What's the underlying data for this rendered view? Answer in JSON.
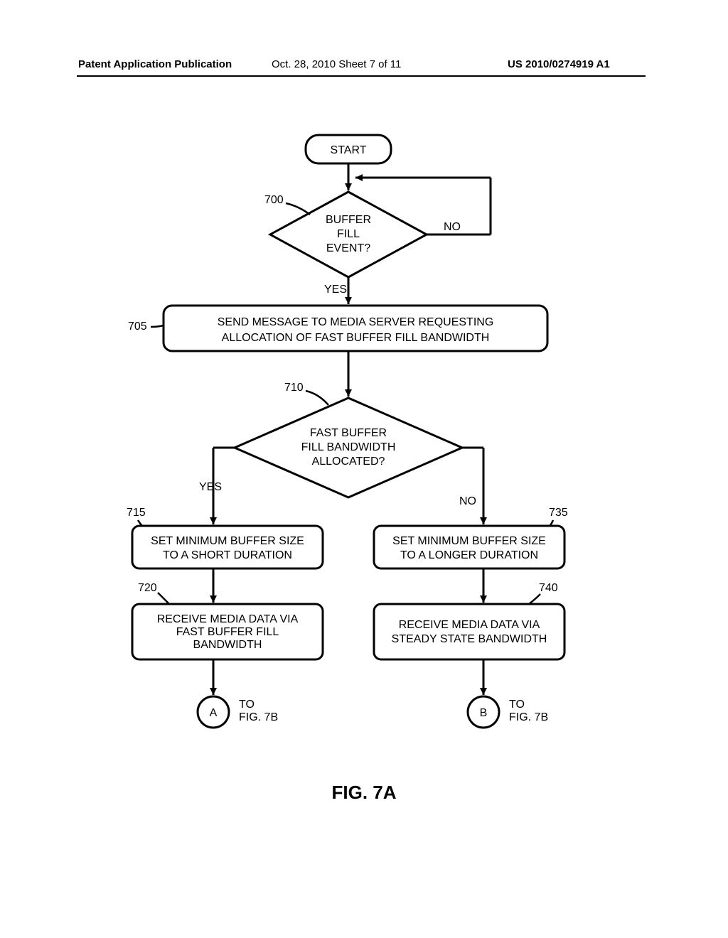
{
  "header": {
    "left": "Patent Application Publication",
    "mid": "Oct. 28, 2010   Sheet 7 of 11",
    "right": "US 2010/0274919 A1"
  },
  "nodes": {
    "start": "START",
    "decision1_l1": "BUFFER",
    "decision1_l2": "FILL",
    "decision1_l3": "EVENT?",
    "process1_l1": "SEND MESSAGE TO MEDIA SERVER REQUESTING",
    "process1_l2": "ALLOCATION OF FAST BUFFER FILL BANDWIDTH",
    "decision2_l1": "FAST BUFFER",
    "decision2_l2": "FILL BANDWIDTH",
    "decision2_l3": "ALLOCATED?",
    "left1_l1": "SET MINIMUM BUFFER SIZE",
    "left1_l2": "TO A SHORT DURATION",
    "left2_l1": "RECEIVE MEDIA DATA VIA",
    "left2_l2": "FAST BUFFER FILL",
    "left2_l3": "BANDWIDTH",
    "right1_l1": "SET MINIMUM BUFFER SIZE",
    "right1_l2": "TO A LONGER DURATION",
    "right2_l1": "RECEIVE MEDIA DATA VIA",
    "right2_l2": "STEADY STATE BANDWIDTH",
    "connA": "A",
    "connB": "B",
    "toA_l1": "TO",
    "toA_l2": "FIG. 7B",
    "toB_l1": "TO",
    "toB_l2": "FIG. 7B"
  },
  "edges": {
    "yes": "YES",
    "no": "NO",
    "yes2": "YES",
    "no2": "NO"
  },
  "refs": {
    "r700": "700",
    "r705": "705",
    "r710": "710",
    "r715": "715",
    "r720": "720",
    "r735": "735",
    "r740": "740"
  },
  "figure": "FIG. 7A"
}
